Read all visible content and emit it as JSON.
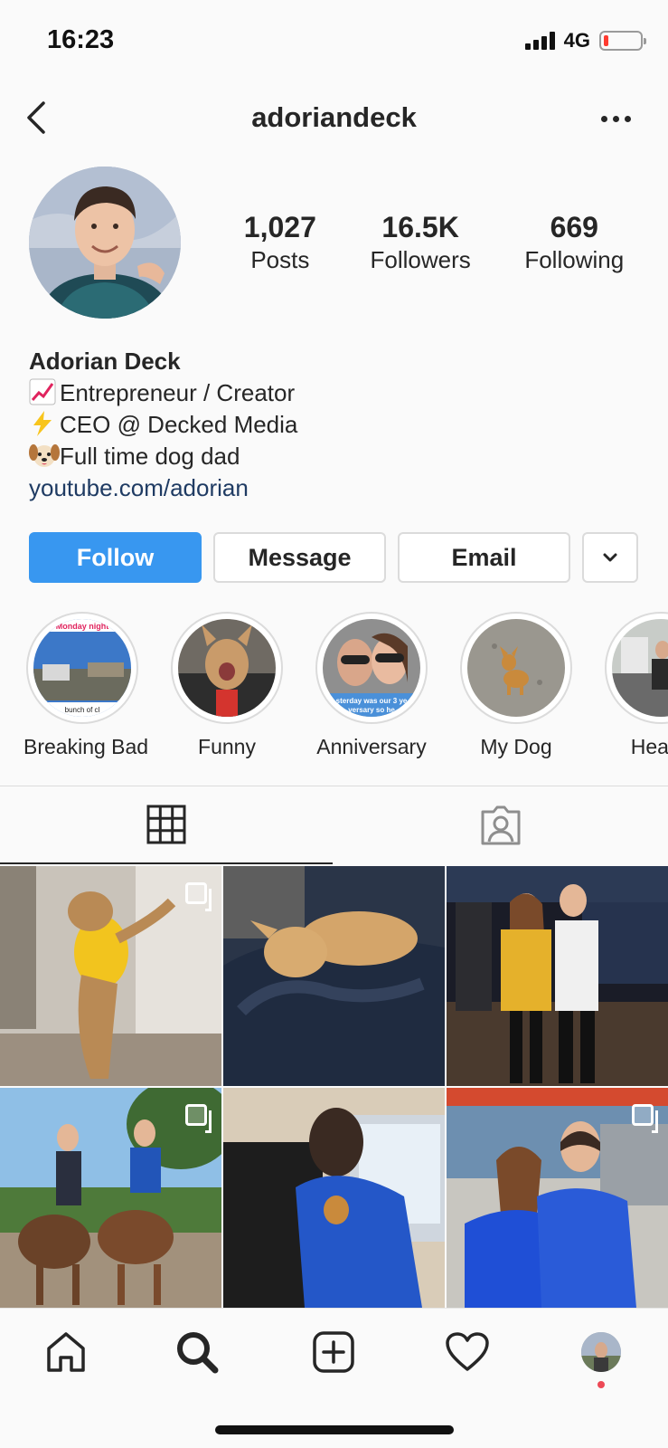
{
  "status_bar": {
    "time": "16:23",
    "network": "4G"
  },
  "header": {
    "username": "adoriandeck"
  },
  "stats": [
    {
      "value": "1,027",
      "label": "Posts"
    },
    {
      "value": "16.5K",
      "label": "Followers"
    },
    {
      "value": "669",
      "label": "Following"
    }
  ],
  "bio": {
    "name": "Adorian Deck",
    "line1": "Entrepreneur / Creator",
    "line2": "CEO @ Decked Media",
    "line3": "Full time dog dad",
    "link": "youtube.com/adorian"
  },
  "actions": {
    "follow": "Follow",
    "message": "Message",
    "email": "Email"
  },
  "highlights": [
    {
      "label": "Breaking Bad"
    },
    {
      "label": "Funny"
    },
    {
      "label": "Anniversary"
    },
    {
      "label": "My Dog"
    },
    {
      "label": "Health"
    }
  ],
  "highlight_overlays": {
    "breaking_bad_top": "Monday night",
    "breaking_bad_bottom": "bunch of cl",
    "anniversary_1": "sterday was our 3 ye",
    "anniversary_2": "versary so he"
  },
  "colors": {
    "accent": "#3897f0",
    "link": "#1f3b63",
    "notification": "#ed4956"
  },
  "icons": {
    "back": "chevron-left-icon",
    "more": "more-horizontal-icon",
    "dropdown": "chevron-down-icon",
    "grid_tab": "grid-icon",
    "tagged_tab": "tagged-person-icon",
    "nav": [
      "home-icon",
      "search-icon",
      "add-post-icon",
      "heart-icon",
      "profile-avatar"
    ]
  },
  "active_tab": "grid",
  "active_nav": "search"
}
